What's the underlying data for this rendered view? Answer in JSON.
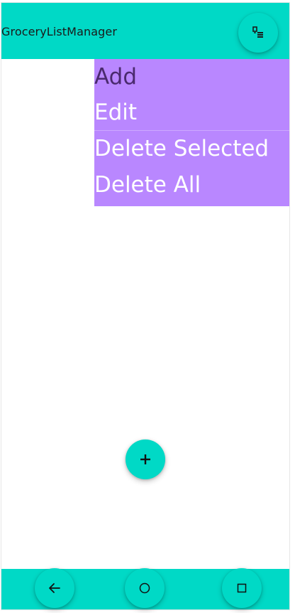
{
  "app": {
    "title": "GroceryListManager"
  },
  "menu": {
    "items": [
      {
        "label": "Add"
      },
      {
        "label": "Edit"
      },
      {
        "label": "Delete Selected"
      },
      {
        "label": "Delete All"
      }
    ]
  },
  "icons": {
    "menu": "checklist-icon",
    "fab": "plus-icon",
    "back": "arrow-back-icon",
    "home": "circle-home-icon",
    "recent": "square-recent-icon"
  },
  "colors": {
    "accent": "#00d9c6",
    "menu_background": "#b987ff",
    "menu_text": "#ffffff",
    "menu_first_text": "#4a2a6e"
  }
}
